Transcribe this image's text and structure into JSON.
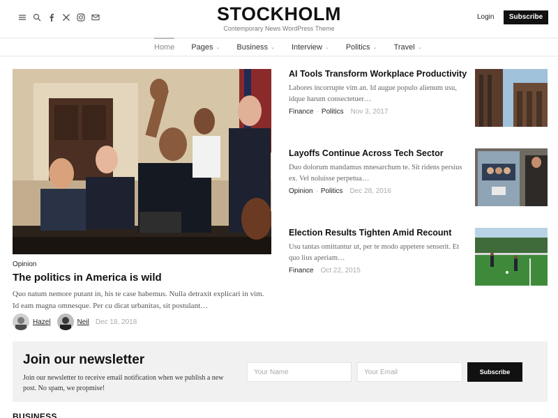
{
  "header": {
    "site_title": "STOCKHOLM",
    "tagline": "Contemporary News WordPress Theme",
    "login_label": "Login",
    "subscribe_label": "Subscribe"
  },
  "nav": {
    "items": [
      {
        "label": "Home",
        "active": true,
        "has_dropdown": false
      },
      {
        "label": "Pages",
        "has_dropdown": true
      },
      {
        "label": "Business",
        "has_dropdown": true
      },
      {
        "label": "Interview",
        "has_dropdown": true
      },
      {
        "label": "Politics",
        "has_dropdown": true
      },
      {
        "label": "Travel",
        "has_dropdown": true
      }
    ]
  },
  "featured": {
    "category": "Opinion",
    "title": "The politics in America is wild",
    "excerpt": "Quo natum nemore putant in, his te case habemus. Nulla detraxit explicari in vim. Id eam magna omnesque. Per cu dicat urbanitas, sit postulant…",
    "authors": [
      "Hazel",
      "Neil"
    ],
    "date": "Dec 18, 2018"
  },
  "side_articles": [
    {
      "title": "AI Tools Transform Workplace Productivity",
      "excerpt": "Labores incorrupte vim an. Id augue populo alienum usu, idque harum consectetuer…",
      "categories": [
        "Finance",
        "Politics"
      ],
      "date": "Nov 3, 2017"
    },
    {
      "title": "Layoffs Continue Across Tech Sector",
      "excerpt": "Duo dolorum mandamus mnesarchum te. Sit ridens persius ex. Vel noluisse perpetua…",
      "categories": [
        "Opinion",
        "Politics"
      ],
      "date": "Dec 28, 2016"
    },
    {
      "title": "Election Results Tighten Amid Recount",
      "excerpt": "Usu tantas omittantur ut, per te modo appetere senserit. Et quo lius aperiam…",
      "categories": [
        "Finance"
      ],
      "date": "Oct 22, 2015"
    }
  ],
  "newsletter": {
    "title": "Join our newsletter",
    "text": "Join our newsletter to receive email notification when we publish a new post. No spam, we propmise!",
    "name_placeholder": "Your Name",
    "email_placeholder": "Your Email",
    "button_label": "Subscribe"
  },
  "sections": {
    "business_heading": "BUSINESS"
  },
  "icons": {
    "menu": "menu-icon",
    "search": "search-icon",
    "facebook": "facebook-icon",
    "x": "x-icon",
    "instagram": "instagram-icon",
    "email": "email-icon"
  },
  "colors": {
    "accent": "#111111",
    "muted_text": "#aaaaaa",
    "newsletter_bg": "#f1f1f1"
  }
}
